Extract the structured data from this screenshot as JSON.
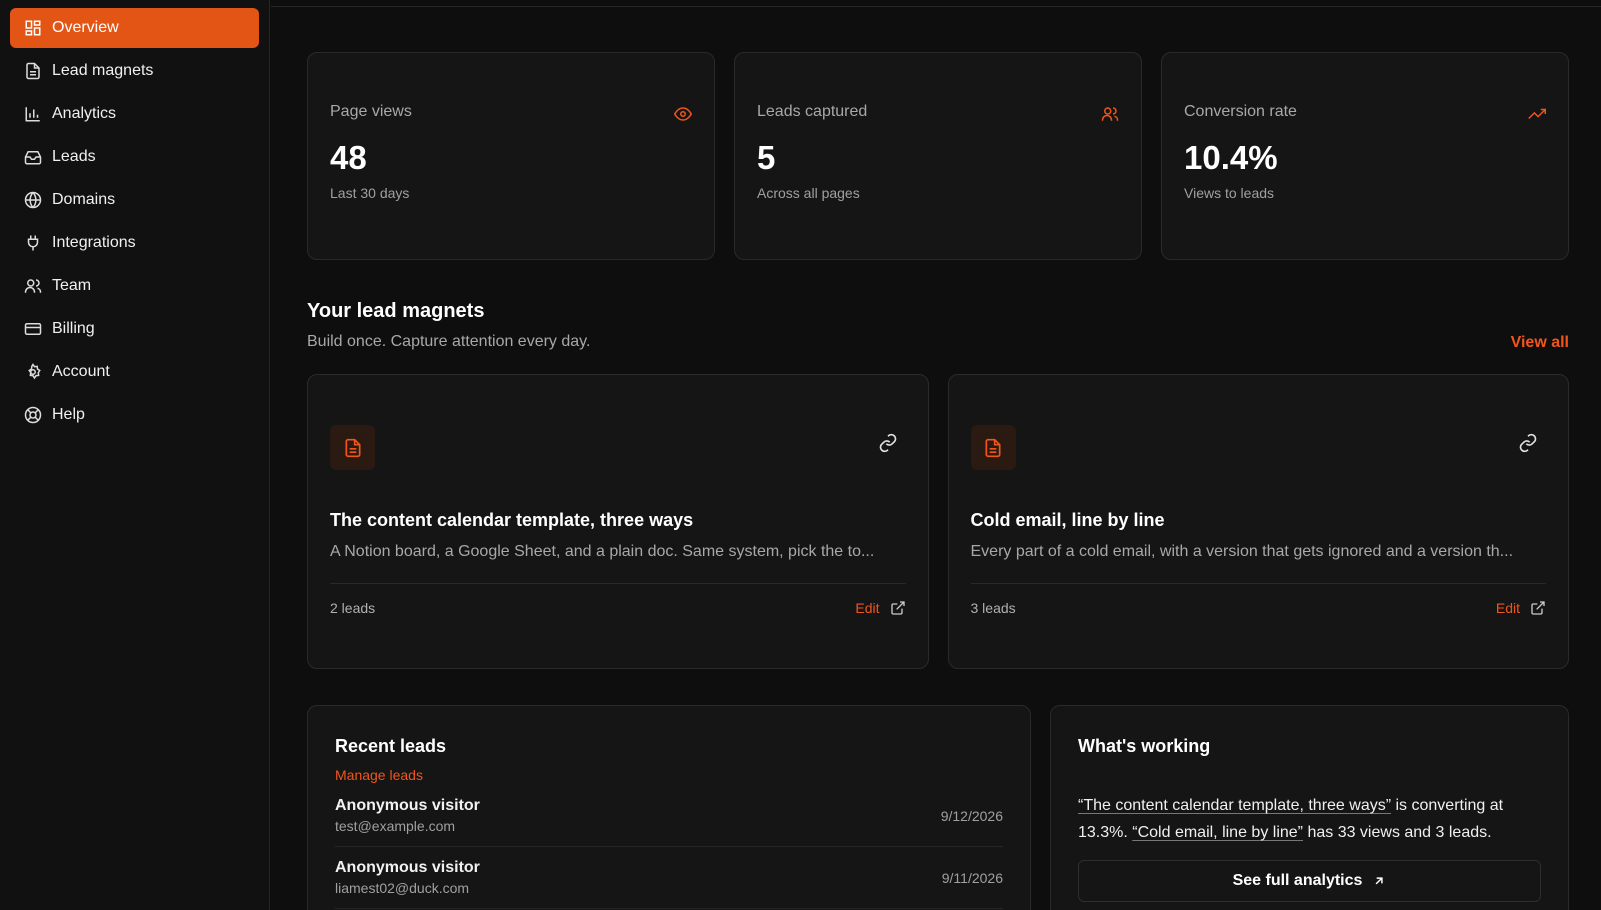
{
  "sidebar": {
    "items": [
      {
        "label": "Overview",
        "icon": "grid-icon",
        "active": true
      },
      {
        "label": "Lead magnets",
        "icon": "document-icon"
      },
      {
        "label": "Analytics",
        "icon": "bar-chart-icon"
      },
      {
        "label": "Leads",
        "icon": "inbox-icon"
      },
      {
        "label": "Domains",
        "icon": "globe-icon"
      },
      {
        "label": "Integrations",
        "icon": "plug-icon"
      },
      {
        "label": "Team",
        "icon": "users-icon"
      },
      {
        "label": "Billing",
        "icon": "credit-card-icon"
      },
      {
        "label": "Account",
        "icon": "gear-icon"
      },
      {
        "label": "Help",
        "icon": "lifebuoy-icon"
      }
    ]
  },
  "stats": [
    {
      "label": "Page views",
      "value": "48",
      "sub": "Last 30 days",
      "icon": "eye-icon"
    },
    {
      "label": "Leads captured",
      "value": "5",
      "sub": "Across all pages",
      "icon": "users-icon"
    },
    {
      "label": "Conversion rate",
      "value": "10.4%",
      "sub": "Views to leads",
      "icon": "trending-up-icon"
    }
  ],
  "magnets_section": {
    "title": "Your lead magnets",
    "subtitle": "Build once. Capture attention every day.",
    "view_all": "View all"
  },
  "magnets": [
    {
      "title": "The content calendar template, three ways",
      "description": "A Notion board, a Google Sheet, and a plain doc. Same system, pick the to...",
      "leads": "2 leads",
      "edit": "Edit"
    },
    {
      "title": "Cold email, line by line",
      "description": "Every part of a cold email, with a version that gets ignored and a version th...",
      "leads": "3 leads",
      "edit": "Edit"
    }
  ],
  "recent_leads": {
    "title": "Recent leads",
    "manage": "Manage leads",
    "rows": [
      {
        "name": "Anonymous visitor",
        "email": "test@example.com",
        "date": "9/12/2026"
      },
      {
        "name": "Anonymous visitor",
        "email": "liamest02@duck.com",
        "date": "9/11/2026"
      }
    ]
  },
  "whats_working": {
    "title": "What's working",
    "magnet1": "“The content calendar template, three ways”",
    "text1": " is converting at 13.3%. ",
    "magnet2": "“Cold email, line by line”",
    "text2": " has 33 views and 3 leads.",
    "button": "See full analytics"
  },
  "colors": {
    "accent": "#e35514",
    "link": "#f0561c"
  }
}
